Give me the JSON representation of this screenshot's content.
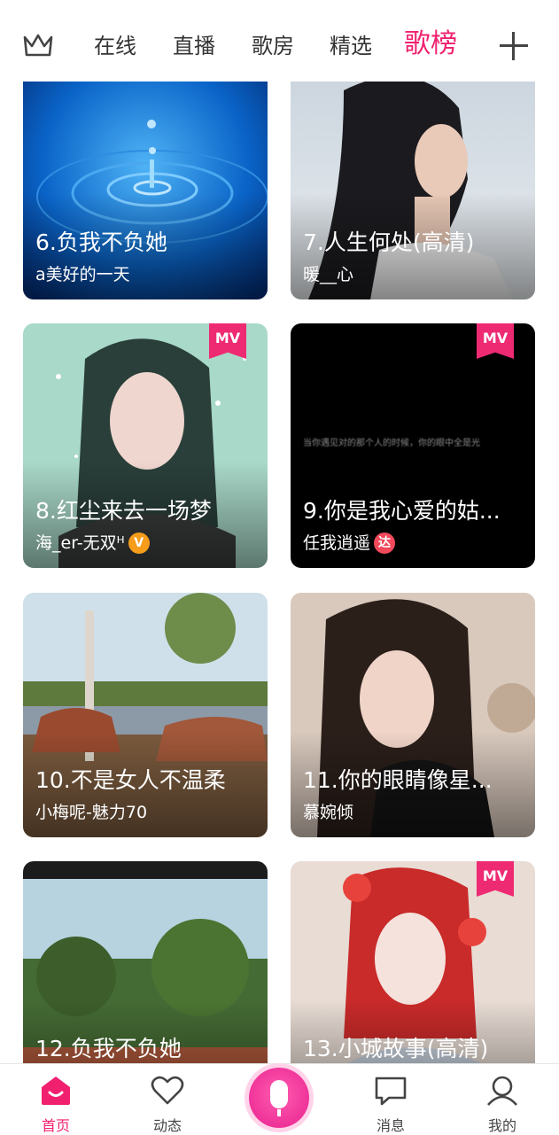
{
  "top_tabs": [
    "在线",
    "直播",
    "歌房",
    "精选",
    "歌榜"
  ],
  "active_tab": "歌榜",
  "cards": [
    {
      "title": "6.负我不负她",
      "user": "a美好的一天",
      "mv": false
    },
    {
      "title": "7.人生何处(高清)",
      "user": "暖__心",
      "mv": false
    },
    {
      "title": "8.红尘来去一场梦",
      "user": "海_er-无双ᴴ",
      "mv": true,
      "badge": "V"
    },
    {
      "title": "9.你是我心爱的姑...",
      "user": "任我逍遥",
      "mv": true,
      "badge": "达",
      "video_caption": "当你遇见对的那个人的时候，你的眼中全是光"
    },
    {
      "title": "10.不是女人不温柔",
      "user": "小梅呢-魅力70",
      "mv": false
    },
    {
      "title": "11.你的眼睛像星...",
      "user": "慕婉倾",
      "mv": false
    },
    {
      "title": "12.负我不负她",
      "user": "",
      "mv": false
    },
    {
      "title": "13.小城故事(高清)",
      "user": "",
      "mv": true
    }
  ],
  "mv_label": "MV",
  "bottom_nav": {
    "home": "首页",
    "feed": "动态",
    "messages": "消息",
    "mine": "我的"
  },
  "colors": {
    "accent": "#f0206f",
    "mv_badge": "#ee2a73"
  },
  "icons": {
    "crown": "crown-icon",
    "plus": "plus-icon",
    "mic": "microphone-icon"
  }
}
